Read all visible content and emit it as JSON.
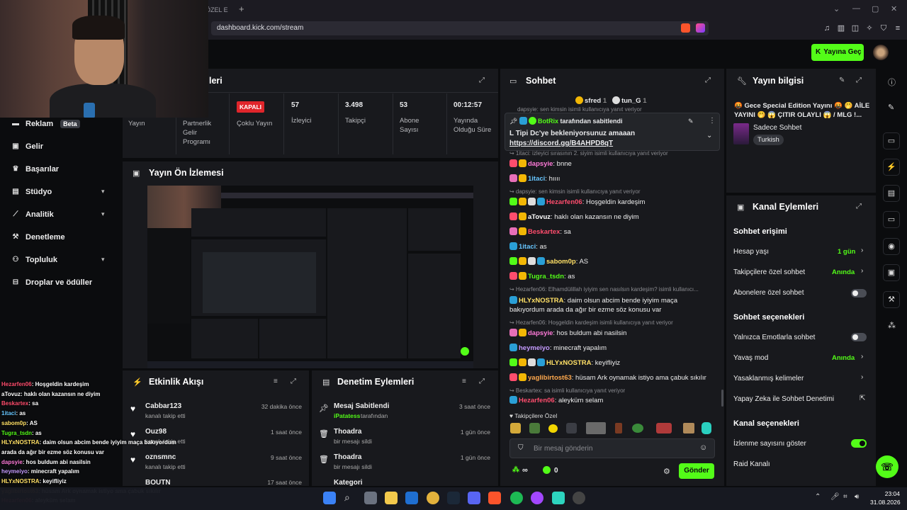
{
  "browser": {
    "tab_title": "ÖZEL E",
    "url": "dashboard.kick.com/stream"
  },
  "header": {
    "go_live": "Yayına Geç"
  },
  "sidebar": {
    "items": [
      {
        "label": "Reklam",
        "badge": "Beta"
      },
      {
        "label": "Gelir"
      },
      {
        "label": "Başarılar"
      },
      {
        "label": "Stüdyo"
      },
      {
        "label": "Analitik"
      },
      {
        "label": "Denetleme"
      },
      {
        "label": "Topluluk"
      },
      {
        "label": "Droplar ve ödüller"
      }
    ]
  },
  "stats": {
    "title_partial": "leri",
    "live_label": "Yayın",
    "partner_label": "Partnerlik Gelir Programı",
    "multistream_badge": "KAPALI",
    "multistream_label": "Çoklu Yayın",
    "viewers_value": "57",
    "viewers_label": "İzleyici",
    "followers_value": "3.498",
    "followers_label": "Takipçi",
    "subs_value": "53",
    "subs_label": "Abone Sayısı",
    "uptime_value": "00:12:57",
    "uptime_label": "Yayında Olduğu Süre"
  },
  "preview": {
    "title": "Yayın Ön İzlemesi"
  },
  "activity": {
    "title": "Etkinlik Akışı",
    "items": [
      {
        "name": "Cabbar123",
        "sub": "kanalı takip etti",
        "time": "32 dakika önce"
      },
      {
        "name": "Ouz98",
        "sub": "kanalı takip etti",
        "time": "1 saat önce"
      },
      {
        "name": "oznsmnc",
        "sub": "kanalı takip etti",
        "time": "9 saat önce"
      },
      {
        "name": "BOUTN",
        "sub": "",
        "time": "17 saat önce"
      }
    ]
  },
  "moderation": {
    "title": "Denetim Eylemleri",
    "items": [
      {
        "name": "Mesaj Sabitlendi",
        "sub_user": "iPatatess",
        "sub": "tarafından",
        "time": "3 saat önce"
      },
      {
        "name": "Thoadra",
        "sub": "bir mesajı sildi",
        "time": "1 gün önce"
      },
      {
        "name": "Thoadra",
        "sub": "bir mesajı sildi",
        "time": "1 gün önce"
      },
      {
        "name": "Kategori",
        "sub": "",
        "time": ""
      }
    ]
  },
  "chat": {
    "title": "Sohbet",
    "top1": "sfred",
    "top1_count": "1",
    "top2": "tun_G",
    "top2_count": "1",
    "pinned_by": "BotRix",
    "pinned_suffix": "tarafından sabitlendi",
    "pinned_text": "L Tipi Dc'ye bekleniyorsunuz amaaan",
    "pinned_link": "https://discord.gg/B4AHPD8qT",
    "pinned_reply_ghost": "dapsyie: sen kimsin isimli kullanıcıya yanıt veriyor",
    "lines": [
      {
        "type": "reply",
        "text": "1itaci: izleyici sırasının 2. siyim isimli kullanıcıya yanıt veriyor"
      },
      {
        "type": "msg",
        "user": "dapsyie",
        "color": "#ff7ad9",
        "text": ": bnne"
      },
      {
        "type": "msg",
        "user": "1itaci",
        "color": "#67c6ff",
        "text": ": hıııı"
      },
      {
        "type": "reply",
        "text": "dapsyie: sen kimsin isimli kullanıcıya yanıt veriyor"
      },
      {
        "type": "msg",
        "user": "Hezarfen06",
        "color": "#ff4d6d",
        "text": ": Hoşgeldin kardeşim"
      },
      {
        "type": "msg",
        "user": "aTovuz",
        "color": "#ffffff",
        "text": ": haklı olan kazansın ne diyim"
      },
      {
        "type": "msg",
        "user": "Beskartex",
        "color": "#ff4d6d",
        "text": ": sa"
      },
      {
        "type": "msg",
        "user": "1itaci",
        "color": "#67c6ff",
        "text": ": as"
      },
      {
        "type": "msg",
        "user": "sabom0p",
        "color": "#ffe066",
        "text": ": AS"
      },
      {
        "type": "msg",
        "user": "Tugra_tsdn",
        "color": "#53fc18",
        "text": ": as"
      },
      {
        "type": "reply",
        "text": "Hezarfen06: Elhamdülillah iyiyim sen nasılsın kardeşim? isimli kullanıcı..."
      },
      {
        "type": "msg",
        "user": "HLYxNOSTRA",
        "color": "#ffe066",
        "text": ": daim olsun abcim bende iyiyim maça"
      },
      {
        "type": "cont",
        "text": "bakıyordum arada da ağır bir ezme söz konusu var"
      },
      {
        "type": "reply",
        "text": "Hezarfen06: Hoşgeldin kardeşim isimli kullanıcıya yanıt veriyor"
      },
      {
        "type": "msg",
        "user": "dapsyie",
        "color": "#ff7ad9",
        "text": ": hos buldum abi nasilsin"
      },
      {
        "type": "msg",
        "user": "heymeiyo",
        "color": "#c59bff",
        "text": ": minecraft yapalım"
      },
      {
        "type": "msg",
        "user": "HLYxNOSTRA",
        "color": "#ffe066",
        "text": ": keyifliyiz"
      },
      {
        "type": "msg",
        "user": "yaglibirtost63",
        "color": "#ffa94d",
        "text": ": hüsam Ark oynamak istiyo ama çabuk sıkılır"
      },
      {
        "type": "reply",
        "text": "Beskartex: sa isimli kullanıcıya yanıt veriyor"
      },
      {
        "type": "msg",
        "user": "Hezarfen06",
        "color": "#ff4d6d",
        "text": ": aleyküm selam"
      }
    ],
    "emote_label": "Takipçilere Özel",
    "input_placeholder": "Bir mesaj gönderin",
    "infinity": "∞",
    "zero": "0",
    "send": "Gönder"
  },
  "stream_info": {
    "title": "Yayın bilgisi",
    "stream_title": "🤬 Gece Special Edition Yayını 🤬 🤭 AİLE YAYINI 🤭 😱 ÇITIR OLAYLI 😱 / MLG !...",
    "category": "Sadece Sohbet",
    "tag": "Turkish"
  },
  "channel_actions": {
    "title": "Kanal Eylemleri",
    "sec1": "Sohbet erişimi",
    "account_age": "Hesap yaşı",
    "account_age_val": "1 gün",
    "followers_only": "Takipçilere özel sohbet",
    "followers_only_val": "Anında",
    "subs_only": "Abonelere özel sohbet",
    "sec2": "Sohbet seçenekleri",
    "emote_only": "Yalnızca Emotlarla sohbet",
    "slow_mode": "Yavaş mod",
    "slow_mode_val": "Anında",
    "banned_words": "Yasaklanmış kelimeler",
    "ai_mod": "Yapay Zeka ile Sohbet Denetimi",
    "sec3": "Kanal seçenekleri",
    "show_viewers": "İzlenme sayısını göster",
    "raid": "Raid Kanalı"
  },
  "overlay_chat": [
    {
      "user": "Hezarfen06",
      "color": "#ff4d6d",
      "text": ": Hoşgeldin kardeşim"
    },
    {
      "user": "aTovuz",
      "color": "#ffffff",
      "text": ": haklı olan kazansın ne diyim"
    },
    {
      "user": "Beskartex",
      "color": "#ff4d6d",
      "text": ": sa"
    },
    {
      "user": "1itaci",
      "color": "#67c6ff",
      "text": ": as"
    },
    {
      "user": "sabom0p",
      "color": "#ffe066",
      "text": ": AS"
    },
    {
      "user": "Tugra_tsdn",
      "color": "#53fc18",
      "text": ": as"
    },
    {
      "user": "HLYxNOSTRA",
      "color": "#ffe066",
      "text": ": daim olsun abcim bende iyiyim maça bakıyordum"
    },
    {
      "user": "",
      "color": "#fff",
      "text": "arada da ağır bir ezme söz konusu var"
    },
    {
      "user": "dapsyie",
      "color": "#ff7ad9",
      "text": ": hos buldum abi nasilsin"
    },
    {
      "user": "heymeiyo",
      "color": "#c59bff",
      "text": ": minecraft yapalım"
    },
    {
      "user": "HLYxNOSTRA",
      "color": "#ffe066",
      "text": ": keyifliyiz"
    },
    {
      "user": "yaglibirtost63",
      "color": "#ffa94d",
      "text": ": hüsam Ark oynamak istiyo ama çabuk sıkılır"
    },
    {
      "user": "Hezarfen06",
      "color": "#ff4d6d",
      "text": ": aleyküm selam"
    }
  ],
  "taskbar": {
    "time": "23:04",
    "date": "31.08.2026"
  },
  "colors": {
    "accent": "#53fc18",
    "panel": "#18191d",
    "bg": "#0b0c0e"
  }
}
